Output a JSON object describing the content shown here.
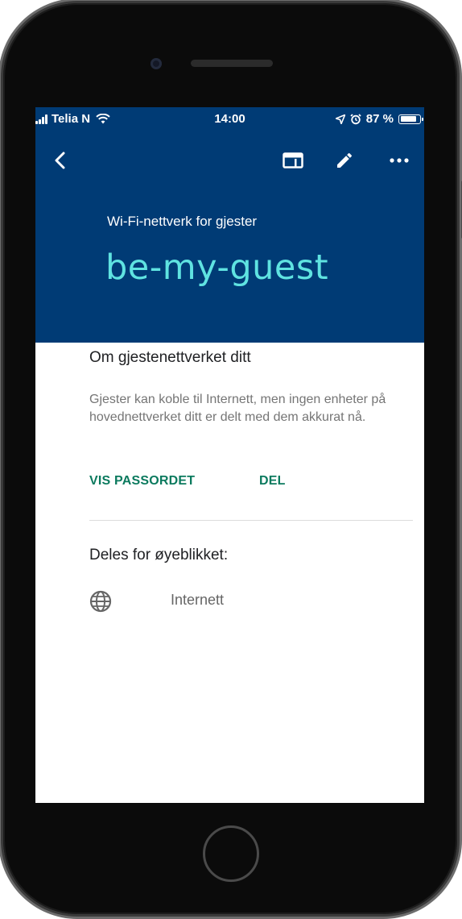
{
  "status_bar": {
    "carrier": "Telia N",
    "time": "14:00",
    "battery_text": "87 %",
    "battery_level": 0.87,
    "icons": [
      "signal-icon",
      "wifi-icon",
      "location-icon",
      "alarm-icon",
      "battery-icon"
    ]
  },
  "toolbar": {
    "back_icon": "back-chevron-icon",
    "actions": [
      "card-view-icon",
      "edit-icon",
      "more-icon"
    ]
  },
  "header": {
    "subtitle": "Wi-Fi-nettverk for gjester",
    "network_name": "be-my-guest"
  },
  "about": {
    "title": "Om gjestenettverket ditt",
    "description": "Gjester kan koble til Internett, men ingen enheter på hovednettverket ditt er delt med dem akkurat nå."
  },
  "actions": {
    "show_password": "VIS PASSORDET",
    "share": "DEL"
  },
  "shared": {
    "title": "Deles for øyeblikket:",
    "items": [
      {
        "icon": "globe-icon",
        "label": "Internett"
      }
    ]
  },
  "colors": {
    "header_bg": "#003b75",
    "accent_cyan": "#5fe3e1",
    "action_green": "#0b7a5e"
  }
}
